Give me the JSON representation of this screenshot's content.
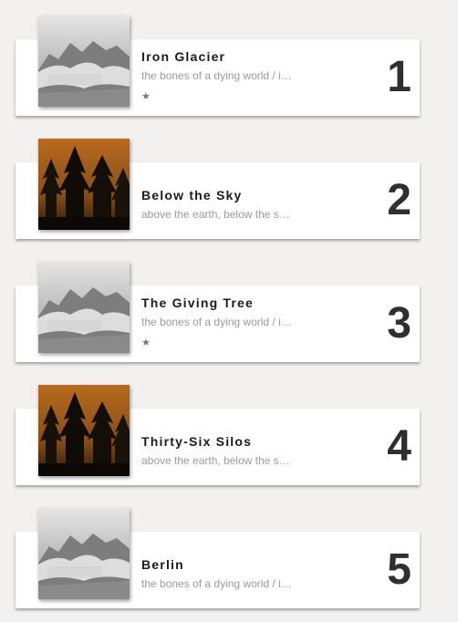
{
  "tracks": [
    {
      "title": "Iron Glacier",
      "subtitle": "the bones of a dying world / i…",
      "rank": "1",
      "starred": true,
      "cover": "mountain",
      "star_glyph": "★"
    },
    {
      "title": "Below the Sky",
      "subtitle": "above the earth, below the s…",
      "rank": "2",
      "starred": false,
      "cover": "forest"
    },
    {
      "title": "The Giving Tree",
      "subtitle": "the bones of a dying world / i…",
      "rank": "3",
      "starred": true,
      "cover": "mountain",
      "star_glyph": "★"
    },
    {
      "title": "Thirty-Six Silos",
      "subtitle": "above the earth, below the s…",
      "rank": "4",
      "starred": false,
      "cover": "forest"
    },
    {
      "title": "Berlin",
      "subtitle": "the bones of a dying world / i…",
      "rank": "5",
      "starred": false,
      "cover": "mountain"
    }
  ],
  "colors": {
    "background": "#f2f1ef",
    "card": "#ffffff",
    "rank": "#2f2f2f",
    "subtitle": "#9a9a9a",
    "forest_sky": "#b86a1e"
  }
}
